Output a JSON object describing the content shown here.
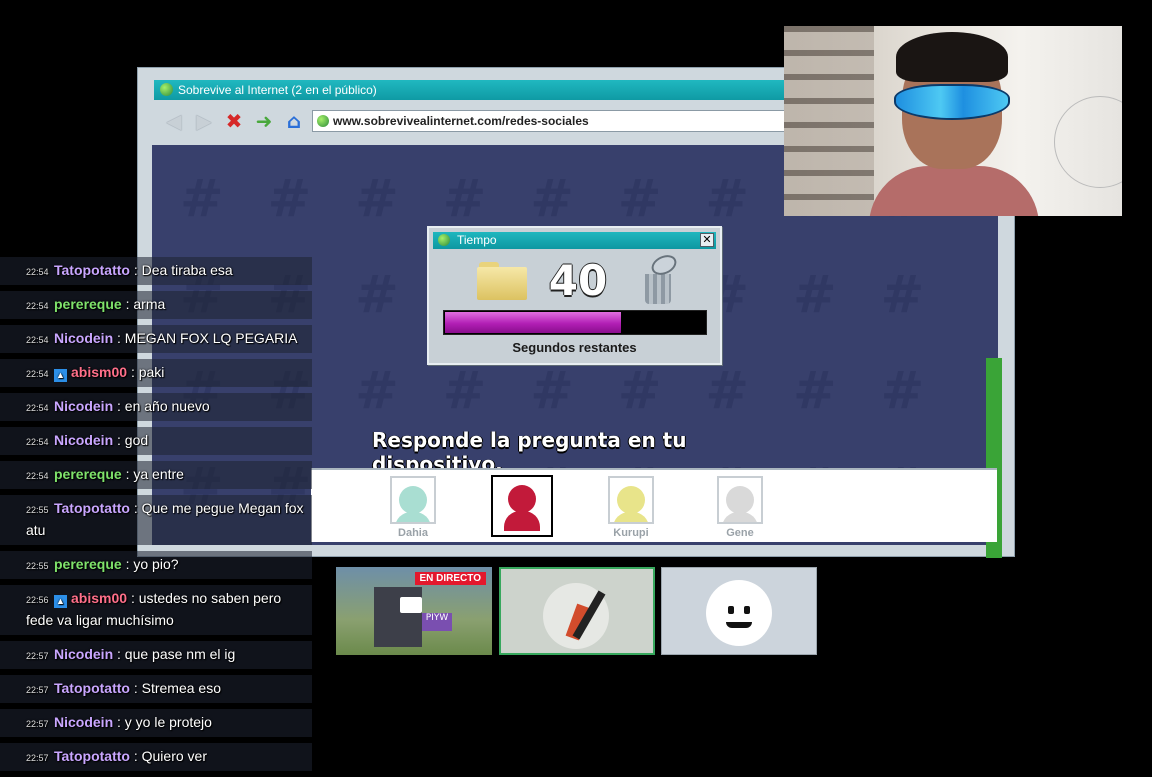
{
  "game_window": {
    "title": "Sobrevive al Internet  (2 en el público)",
    "address": "www.sobrevivealinternet.com/redes-sociales",
    "toolbar_icons": [
      "back-arrow-icon",
      "forward-arrow-icon",
      "stop-icon",
      "go-icon",
      "home-icon"
    ]
  },
  "timer": {
    "title": "Tiempo",
    "close_label": "✕",
    "seconds": "40",
    "progress_fraction": 0.67,
    "caption": "Segundos restantes",
    "colors": {
      "progress": "#b21fb5",
      "title_bar": "#0f9aa4"
    }
  },
  "prompt": "Responde la pregunta en tu dispositivo.",
  "players": [
    {
      "name": "Dahia",
      "color": "#a9ded2",
      "active": false
    },
    {
      "name": "",
      "color": "#c21a3a",
      "active": true
    },
    {
      "name": "Kurupi",
      "color": "#e8e48a",
      "active": false
    },
    {
      "name": "Gene",
      "color": "#d9d9d9",
      "active": false
    }
  ],
  "chat": [
    {
      "time": "22:54",
      "user": "Tatopotatto",
      "user_color": "#c9a6ff",
      "badge": false,
      "message": ": Dea tiraba esa"
    },
    {
      "time": "22:54",
      "user": "perereque",
      "user_color": "#7fe36b",
      "badge": false,
      "message": ": arma"
    },
    {
      "time": "22:54",
      "user": "Nicodein",
      "user_color": "#c9a6ff",
      "badge": false,
      "message": ": MEGAN FOX LQ PEGARIA"
    },
    {
      "time": "22:54",
      "user": "abism00",
      "user_color": "#ff6f8a",
      "badge": true,
      "message": ": paki"
    },
    {
      "time": "22:54",
      "user": "Nicodein",
      "user_color": "#c9a6ff",
      "badge": false,
      "message": ": en año nuevo"
    },
    {
      "time": "22:54",
      "user": "Nicodein",
      "user_color": "#c9a6ff",
      "badge": false,
      "message": ": god"
    },
    {
      "time": "22:54",
      "user": "perereque",
      "user_color": "#7fe36b",
      "badge": false,
      "message": ": ya entre"
    },
    {
      "time": "22:55",
      "user": "Tatopotatto",
      "user_color": "#c9a6ff",
      "badge": false,
      "message": ": Que me pegue Megan fox atu"
    },
    {
      "time": "22:55",
      "user": "perereque",
      "user_color": "#7fe36b",
      "badge": false,
      "message": ": yo pio?"
    },
    {
      "time": "22:56",
      "user": "abism00",
      "user_color": "#ff6f8a",
      "badge": true,
      "message": ": ustedes no saben pero fede va ligar muchísimo"
    },
    {
      "time": "22:57",
      "user": "Nicodein",
      "user_color": "#c9a6ff",
      "badge": false,
      "message": ": que pase nm el ig"
    },
    {
      "time": "22:57",
      "user": "Tatopotatto",
      "user_color": "#c9a6ff",
      "badge": false,
      "message": ": Stremea eso"
    },
    {
      "time": "22:57",
      "user": "Nicodein",
      "user_color": "#c9a6ff",
      "badge": false,
      "message": ": y yo le protejo"
    },
    {
      "time": "22:57",
      "user": "Tatopotatto",
      "user_color": "#c9a6ff",
      "badge": false,
      "message": ": Quiero ver"
    }
  ],
  "scenes": [
    {
      "live_label": "EN DIRECTO",
      "mini_label": "PIYW"
    },
    {
      "selected": true
    },
    {}
  ]
}
